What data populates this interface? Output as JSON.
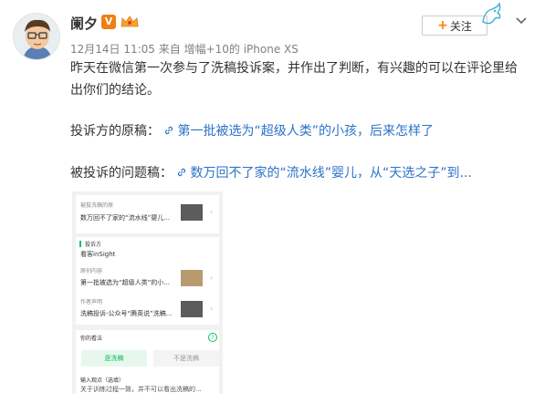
{
  "user": {
    "name": "阑夕",
    "verified_badge": "V",
    "meta": "12月14日 11:05 来自 增幅+10的 iPhone XS"
  },
  "actions": {
    "follow_plus": "+",
    "follow_label": "关注"
  },
  "post": {
    "line1": "昨天在微信第一次参与了洗稿投诉案，并作出了判断，有兴趣的可以在评论里给",
    "line2": "出你们的结论。",
    "original_label": "投诉方的原稿：",
    "original_link": "第一批被选为“超级人类”的小孩，后来怎样了",
    "accused_label": "被投诉的问题稿：",
    "accused_link": "数万回不了家的“流水线”婴儿，从“天选之子”到..."
  },
  "screenshot": {
    "card1_tag": "被投洗稿的原",
    "card1_text": "数万回不了家的“流水线”婴儿...",
    "complainant_label": "投诉方",
    "complainant_name": "看客inSight",
    "card2_tag": "原创内容",
    "card2_text": "第一批被选为“超级人类”的小...",
    "card3_tag": "作者声明",
    "card3_text": "洗稿投诉-公众号“腾英说”洗稿...",
    "opinion_label": "你的看法",
    "opinion_help": "?",
    "btn_yes": "是洗稿",
    "btn_no": "不是洗稿",
    "input_label": "输入观点（选填）",
    "input_text": "关于训练过程一致，并不可以看出洗稿的..."
  },
  "colors": {
    "link": "#2c72c7",
    "accent_orange": "#ff8200",
    "wechat_green": "#07c160"
  },
  "icons": [
    "avatar-image",
    "verified-v-icon",
    "crown-icon",
    "bird-mascot-icon",
    "chevron-down-icon",
    "link-icon"
  ]
}
